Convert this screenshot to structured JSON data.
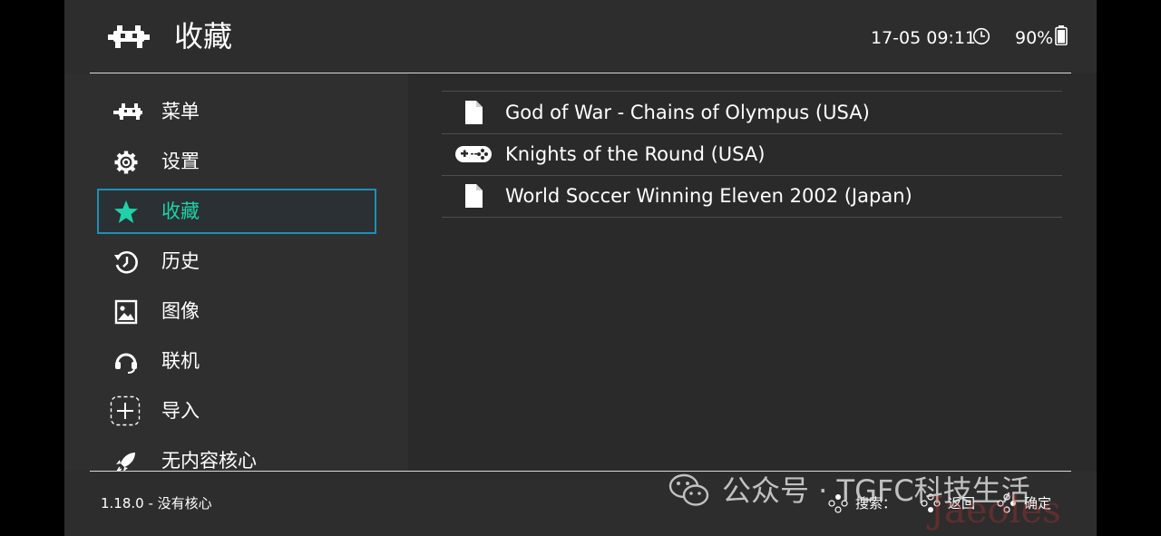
{
  "header": {
    "title": "收藏",
    "clock": "17-05 09:11",
    "battery": "90%"
  },
  "sidebar": {
    "items": [
      {
        "label": "菜单",
        "icon": "retroarch-icon"
      },
      {
        "label": "设置",
        "icon": "gear-icon"
      },
      {
        "label": "收藏",
        "icon": "star-icon",
        "active": true
      },
      {
        "label": "历史",
        "icon": "history-icon"
      },
      {
        "label": "图像",
        "icon": "image-icon"
      },
      {
        "label": "联机",
        "icon": "netplay-icon"
      },
      {
        "label": "导入",
        "icon": "add-icon"
      },
      {
        "label": "无内容核心",
        "icon": "rocket-icon"
      }
    ]
  },
  "content": {
    "items": [
      {
        "label": "God of War - Chains of Olympus (USA)",
        "icon": "file-icon"
      },
      {
        "label": "Knights of the Round (USA)",
        "icon": "gamepad-icon"
      },
      {
        "label": "World Soccer Winning Eleven 2002 (Japan)",
        "icon": "file-icon"
      }
    ]
  },
  "footer": {
    "version": "1.18.0 - 没有核心",
    "hints": [
      {
        "label": "搜索：",
        "icon": "controller-buttons-icon"
      },
      {
        "label": "返回",
        "icon": "controller-buttons-icon"
      },
      {
        "label": "确定",
        "icon": "controller-buttons-icon"
      }
    ]
  },
  "watermark": {
    "text": "公众号 · TGFC科技生活",
    "text2": "Jaeoles"
  },
  "colors": {
    "background": "#2d2d2d",
    "accent": "#1fd2a8",
    "selection_border": "#1f8fb4",
    "text": "#ffffff"
  }
}
